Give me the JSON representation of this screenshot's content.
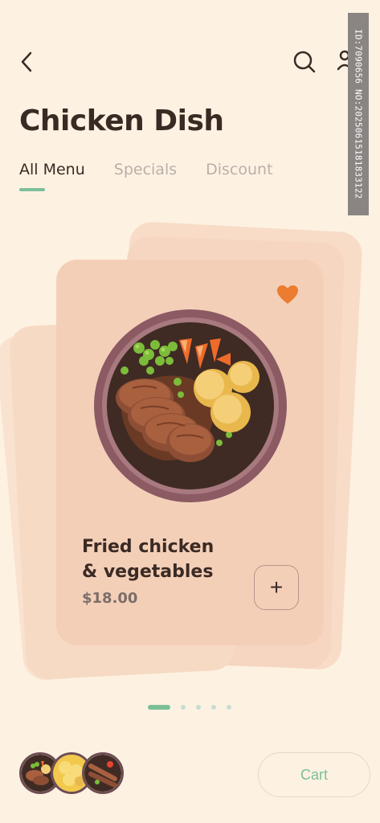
{
  "header": {
    "back_icon": "chevron-left-icon",
    "search_icon": "search-icon",
    "profile_icon": "profile-icon"
  },
  "page_title": "Chicken Dish",
  "tabs": [
    {
      "label": "All Menu",
      "active": true
    },
    {
      "label": "Specials",
      "active": false
    },
    {
      "label": "Discount",
      "active": false
    }
  ],
  "card": {
    "name_line1": "Fried chicken",
    "name_line2": "& vegetables",
    "price": "$18.00",
    "add_label": "+",
    "favorite": true,
    "favorite_color": "#ec7c2f"
  },
  "pagination": {
    "pages": 5,
    "current": 1
  },
  "bottom": {
    "cart_label": "Cart",
    "thumbnails": 3
  },
  "watermark": "ID:7090656 NO:20250615181833122",
  "colors": {
    "background": "#fdf2e2",
    "accent": "#7bbf99",
    "card": "#f4cfb8",
    "text": "#3a2a24"
  }
}
